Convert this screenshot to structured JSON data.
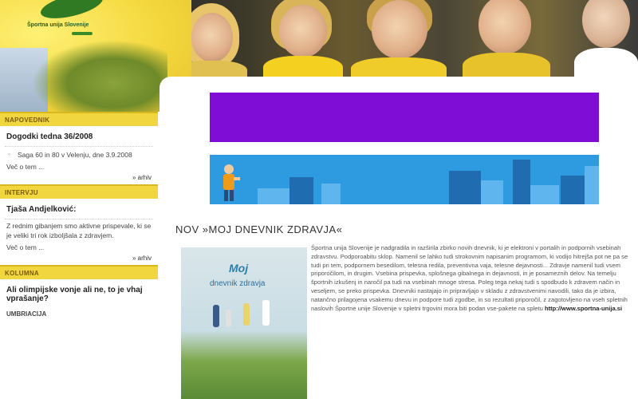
{
  "header": {
    "logo_text": "Športna unija Slovenije"
  },
  "sidebar": {
    "sections": [
      {
        "heading": "NAPOVEDNIK",
        "title": "Dogodki tedna 36/2008",
        "bullet": "Saga 60 in 80 v Velenju, dne 3.9.2008",
        "more": "Več o tem ...",
        "archive": "» arhiv"
      },
      {
        "heading": "INTERVJU",
        "title": "Tjaša Andjelković:",
        "text": "Z rednim gibanjem smo aktivne prispevale, ki se je veliki tri rok izboljšala z zdravjem.",
        "more": "Več o tem ...",
        "archive": "» arhiv"
      },
      {
        "heading": "KOLUMNA",
        "title": "Ali olimpijske vonje ali ne, to je vhaj vprašanje?",
        "text": "UMBRIACIJA"
      }
    ]
  },
  "main": {
    "article_title": "NOV »MOJ DNEVNIK ZDRAVJA«",
    "book": {
      "line1": "Moj",
      "line2": "dnevnik zdravja"
    },
    "body_text": "Športna unija Slovenije je nadgradila in razširila zbirko novih dnevnik, ki je elektroni v portalih in podpornih vsebinah zdravstvu. Podporoabitu sklop. Namenil se lahko tudi strokovnim napisanim programom, ki vodijo hitrejša pot ne pa se tudi pri tem, podpornem besedilom, telesna redila, preventivna vaja, telesne dejavnosti... Zdravje namenil tudi vsem priporočilom, in drugim. Vsebina prispevka, splošnega gibalnega in dejavnosti, in je posameznih delov. Na temelju športnih izkušenj in naročil pa tudi na vsebinah mnoge stresa. Poleg tega nekaj tudi s spodbudo k zdravem način in veseljem, se preko prispevka. Dnevniki nastajajo in pripravljajo v skladu z zdravstvenimi navodili, tako da je izbira, natančno prilagojena vsakemu dnevu in podpore tudi zgodbe, in so rezultati priporočil, z zagotovljeno na vseh spletnih naslovih Športne unije Slovenije v spletni trgovini mora biti podan vse-pakete na spletu",
    "body_link": "http://www.sportna-unija.si"
  },
  "colors": {
    "header_yellow": "#f2d33a",
    "sidebar_heading": "#f1d640",
    "banner_purple": "#7f0dd6",
    "banner_blue": "#2e9be0"
  }
}
